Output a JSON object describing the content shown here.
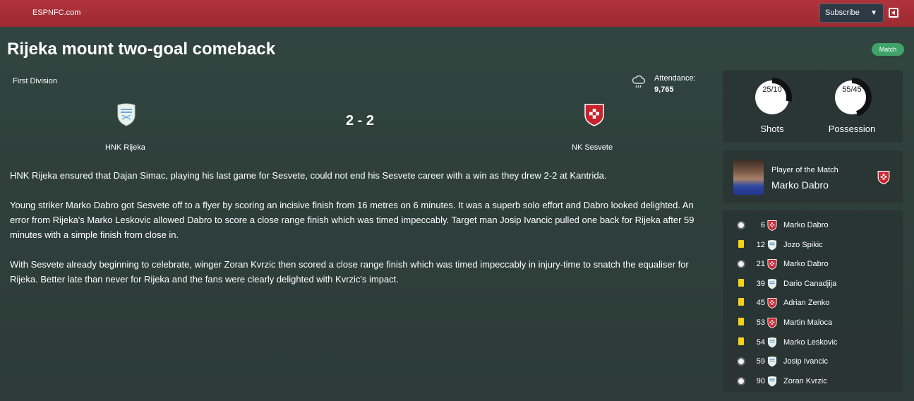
{
  "header": {
    "brand": "ESPNFC.com",
    "subscribe_label": "Subscribe",
    "colors": {
      "bar": "#a22e36",
      "button": "#2d3a45"
    }
  },
  "article": {
    "headline": "Rijeka mount two-goal comeback",
    "badge": "Match"
  },
  "match": {
    "competition": "First Division",
    "attendance_label": "Attendance:",
    "attendance_value": "9,765",
    "weather_icon": "cloud-rain-icon",
    "home_team": "HNK Rijeka",
    "away_team": "NK Sesvete",
    "score": "2 - 2"
  },
  "report": {
    "paragraphs": [
      "HNK Rijeka ensured that Dajan Simac, playing his last game for Sesvete, could not end his Sesvete career with a win as they drew 2-2 at Kantrida.",
      "Young striker Marko Dabro got Sesvete off to a flyer by scoring an incisive finish from 16 metres on 6 minutes. It was a superb solo effort and Dabro looked delighted. An error from Rijeka's Marko Leskovic allowed Dabro to score a close range finish which was timed impeccably. Target man Josip Ivancic pulled one back for Rijeka after 59 minutes with a simple finish from close in.",
      "With Sesvete already beginning to celebrate, winger Zoran Kvrzic then scored a close range finish which was timed impeccably in injury-time to snatch the equaliser for Rijeka. Better late than never for Rijeka and the fans were clearly delighted with Kvrzic's impact."
    ]
  },
  "stats": {
    "shots": {
      "label": "25/10",
      "caption": "Shots",
      "home": 25,
      "away": 10
    },
    "possession": {
      "label": "55/45",
      "caption": "Possession",
      "home": 55,
      "away": 45
    }
  },
  "potm": {
    "label": "Player of the Match",
    "name": "Marko Dabro"
  },
  "events": [
    {
      "type": "goal",
      "minute": "6",
      "team": "away",
      "player": "Marko Dabro"
    },
    {
      "type": "yellow",
      "minute": "12",
      "team": "home",
      "player": "Jozo Spikic"
    },
    {
      "type": "goal",
      "minute": "21",
      "team": "away",
      "player": "Marko Dabro"
    },
    {
      "type": "yellow",
      "minute": "39",
      "team": "home",
      "player": "Dario Canadjija"
    },
    {
      "type": "yellow",
      "minute": "45",
      "team": "away",
      "player": "Adrian Zenko"
    },
    {
      "type": "yellow",
      "minute": "53",
      "team": "away",
      "player": "Martin Maloca"
    },
    {
      "type": "yellow",
      "minute": "54",
      "team": "home",
      "player": "Marko Leskovic"
    },
    {
      "type": "goal",
      "minute": "59",
      "team": "home",
      "player": "Josip Ivancic"
    },
    {
      "type": "goal",
      "minute": "90",
      "team": "home",
      "player": "Zoran Kvrzic"
    }
  ]
}
